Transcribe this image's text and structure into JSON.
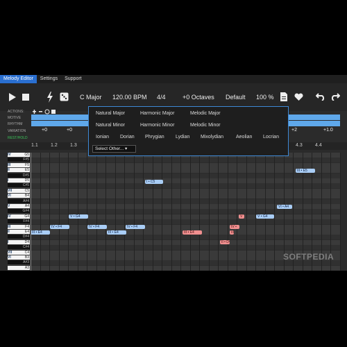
{
  "menu": {
    "tabs": [
      "Melody Editor",
      "Settings",
      "Support"
    ]
  },
  "transport": {
    "key": "C Major",
    "bpm": "120.00 BPM",
    "meter": "4/4",
    "octaves": "+0 Octaves",
    "preset": "Default",
    "zoom": "100 %"
  },
  "tracks": {
    "labels": [
      "ACTIONS:",
      "MOTIVE",
      "RHYTHM",
      "VARIATION",
      "REST/HOLD"
    ],
    "variation_values": [
      "+0",
      "+0",
      "+2",
      "+1.0"
    ]
  },
  "dropdown": {
    "row1": [
      "Natural Major",
      "Harmonic Major",
      "Melodic Major"
    ],
    "row2": [
      "Natural Minor",
      "Harmonic Minor",
      "Melodic Minor"
    ],
    "row3": [
      "Ionian",
      "Dorian",
      "Phrygian",
      "Lydian",
      "Mixolydian",
      "Aeolian",
      "Locrian"
    ],
    "select_label": "Select Other..."
  },
  "ruler": [
    "1.1",
    "1.2",
    "1.3",
    "4.3",
    "4.4"
  ],
  "keys": [
    "G5",
    "F#5",
    "F5",
    "E5",
    "D#5",
    "D5",
    "C#5",
    "C5",
    "B4",
    "A#4",
    "A4",
    "G#4",
    "G4",
    "F#4",
    "F4",
    "E4",
    "D#4",
    "D4",
    "C#4",
    "C4",
    "B3",
    "A#3",
    "A3"
  ],
  "degrees": [
    "IV",
    "III",
    "II",
    "I",
    "VII",
    "VI",
    "V",
    "IV",
    "III",
    "II",
    "I",
    "VII",
    "VI"
  ],
  "notes": [
    {
      "label": "III • E5",
      "color": "blue"
    },
    {
      "label": "I • C5",
      "color": "blue"
    },
    {
      "label": "VI • A4",
      "color": "blue"
    },
    {
      "label": "V • G4",
      "color": "blue"
    },
    {
      "label": "V • G4",
      "color": "blue"
    },
    {
      "label": "V",
      "color": "red"
    },
    {
      "label": "IV • F4",
      "color": "blue"
    },
    {
      "label": "IV • F4",
      "color": "blue"
    },
    {
      "label": "IV • F4",
      "color": "blue"
    },
    {
      "label": "IV •",
      "color": "red"
    },
    {
      "label": "III • E4",
      "color": "blue"
    },
    {
      "label": "III • E4",
      "color": "blue"
    },
    {
      "label": "III • E4",
      "color": "red"
    },
    {
      "label": "III",
      "color": "red"
    },
    {
      "label": "II • D4",
      "color": "red"
    }
  ],
  "watermark": "SOFTPEDIA",
  "colors": {
    "accent": "#2a6fd0",
    "note_blue": "#a9cdf5",
    "note_red": "#f08f8f",
    "track": "#5fa8ea"
  }
}
